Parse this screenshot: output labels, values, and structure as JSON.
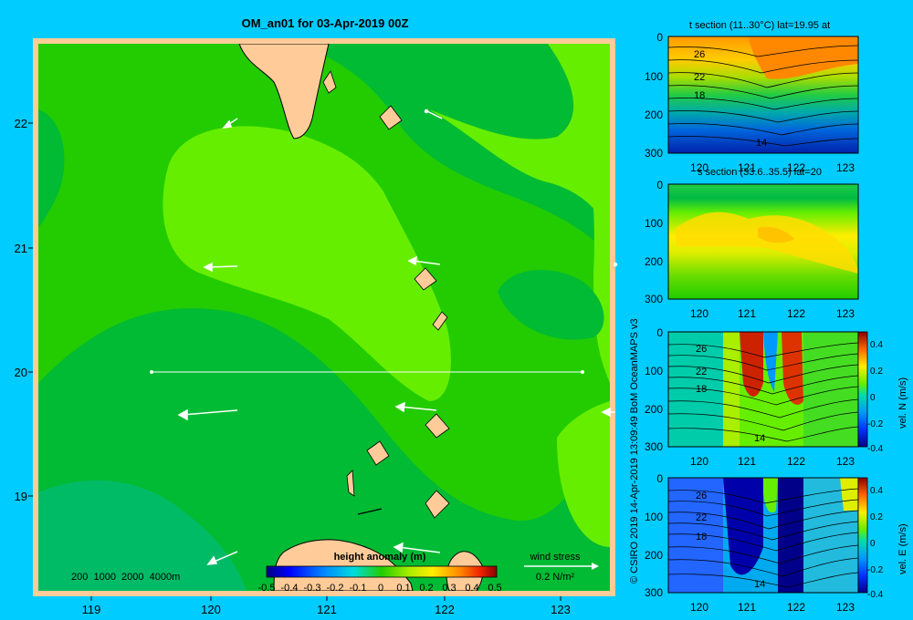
{
  "title": "OM_an01 for 03-Apr-2019 00Z",
  "colors": {
    "background": "#00ccff",
    "sea_dark": "#00bb33",
    "sea_mid": "#22cc00",
    "sea_light": "#66ee00",
    "sea_teal": "#00bb66",
    "land": "#ffcc99",
    "arrow": "#ffffff"
  },
  "main_map": {
    "lon_ticks": [
      "119",
      "120",
      "121",
      "122",
      "123"
    ],
    "lat_ticks": [
      "22",
      "21",
      "20",
      "19"
    ],
    "depth_legend": "200  1000  2000  4000m",
    "colorbar_title": "height anomaly (m)",
    "colorbar_ticks": [
      "-0.5",
      "-0.4",
      "-0.3",
      "-0.2",
      "-0.1",
      "0",
      "0.1",
      "0.2",
      "0.3",
      "0.4",
      "0.5"
    ],
    "wind_label": "wind stress",
    "wind_scale": "0.2 N/m²",
    "section_lat": 20
  },
  "credit": "© CSIRO 2019  14-Apr-2019 13:09:49 BoM OceanMAPS v3",
  "panels": [
    {
      "id": "t-section",
      "title": "t section (11..30°C) lat=19.95 at",
      "depth_ticks": [
        "0",
        "100",
        "200",
        "300"
      ],
      "lon_ticks": [
        "120",
        "121",
        "122",
        "123"
      ],
      "contour_labels": [
        "26",
        "22",
        "18",
        "14"
      ]
    },
    {
      "id": "s-section",
      "title": "s section (33.6..35.5) lat=20",
      "depth_ticks": [
        "0",
        "100",
        "200",
        "300"
      ],
      "lon_ticks": [
        "120",
        "121",
        "122",
        "123"
      ],
      "contour_labels": []
    },
    {
      "id": "vel-n-section",
      "title": "",
      "depth_ticks": [
        "0",
        "100",
        "200",
        "300"
      ],
      "lon_ticks": [
        "120",
        "121",
        "122",
        "123"
      ],
      "contour_labels": [
        "26",
        "22",
        "18",
        "14"
      ],
      "colorbar_label": "vel. N (m/s)",
      "colorbar_ticks": [
        "0.4",
        "0.2",
        "0",
        "-0.2",
        "-0.4"
      ]
    },
    {
      "id": "vel-e-section",
      "title": "",
      "depth_ticks": [
        "0",
        "100",
        "200",
        "300"
      ],
      "lon_ticks": [
        "120",
        "121",
        "122",
        "123"
      ],
      "contour_labels": [
        "26",
        "22",
        "18",
        "14"
      ],
      "colorbar_label": "vel. E (m/s)",
      "colorbar_ticks": [
        "0.4",
        "0.2",
        "0",
        "-0.2",
        "-0.4"
      ]
    }
  ]
}
